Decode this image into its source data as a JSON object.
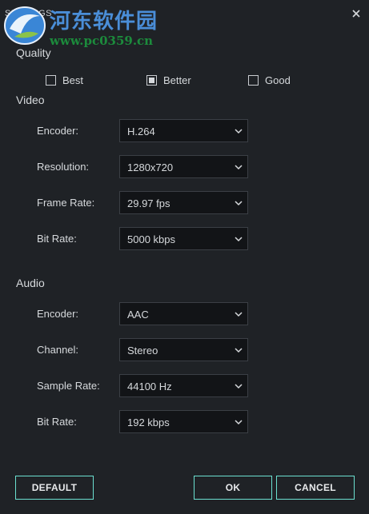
{
  "window": {
    "title": "SETTINGS"
  },
  "watermark": {
    "site_name": "河东软件园",
    "url": "www.pc0359.cn"
  },
  "quality": {
    "label": "Quality",
    "options": [
      {
        "label": "Best",
        "checked": false
      },
      {
        "label": "Better",
        "checked": true
      },
      {
        "label": "Good",
        "checked": false
      }
    ]
  },
  "video": {
    "label": "Video",
    "fields": [
      {
        "label": "Encoder:",
        "value": "H.264"
      },
      {
        "label": "Resolution:",
        "value": "1280x720"
      },
      {
        "label": "Frame Rate:",
        "value": "29.97 fps"
      },
      {
        "label": "Bit Rate:",
        "value": "5000 kbps"
      }
    ]
  },
  "audio": {
    "label": "Audio",
    "fields": [
      {
        "label": "Encoder:",
        "value": "AAC"
      },
      {
        "label": "Channel:",
        "value": "Stereo"
      },
      {
        "label": "Sample Rate:",
        "value": "44100 Hz"
      },
      {
        "label": "Bit Rate:",
        "value": "192 kbps"
      }
    ]
  },
  "buttons": {
    "default": "DEFAULT",
    "ok": "OK",
    "cancel": "CANCEL"
  },
  "colors": {
    "background": "#1f2226",
    "accent": "#6be0d0",
    "dropdown_bg": "#121417",
    "watermark_title": "#4a8ed8",
    "watermark_url": "#1c8b3c"
  },
  "icons": {
    "close": "close-icon",
    "dropdown": "chevron-down-icon",
    "logo": "watermark-logo-icon"
  }
}
